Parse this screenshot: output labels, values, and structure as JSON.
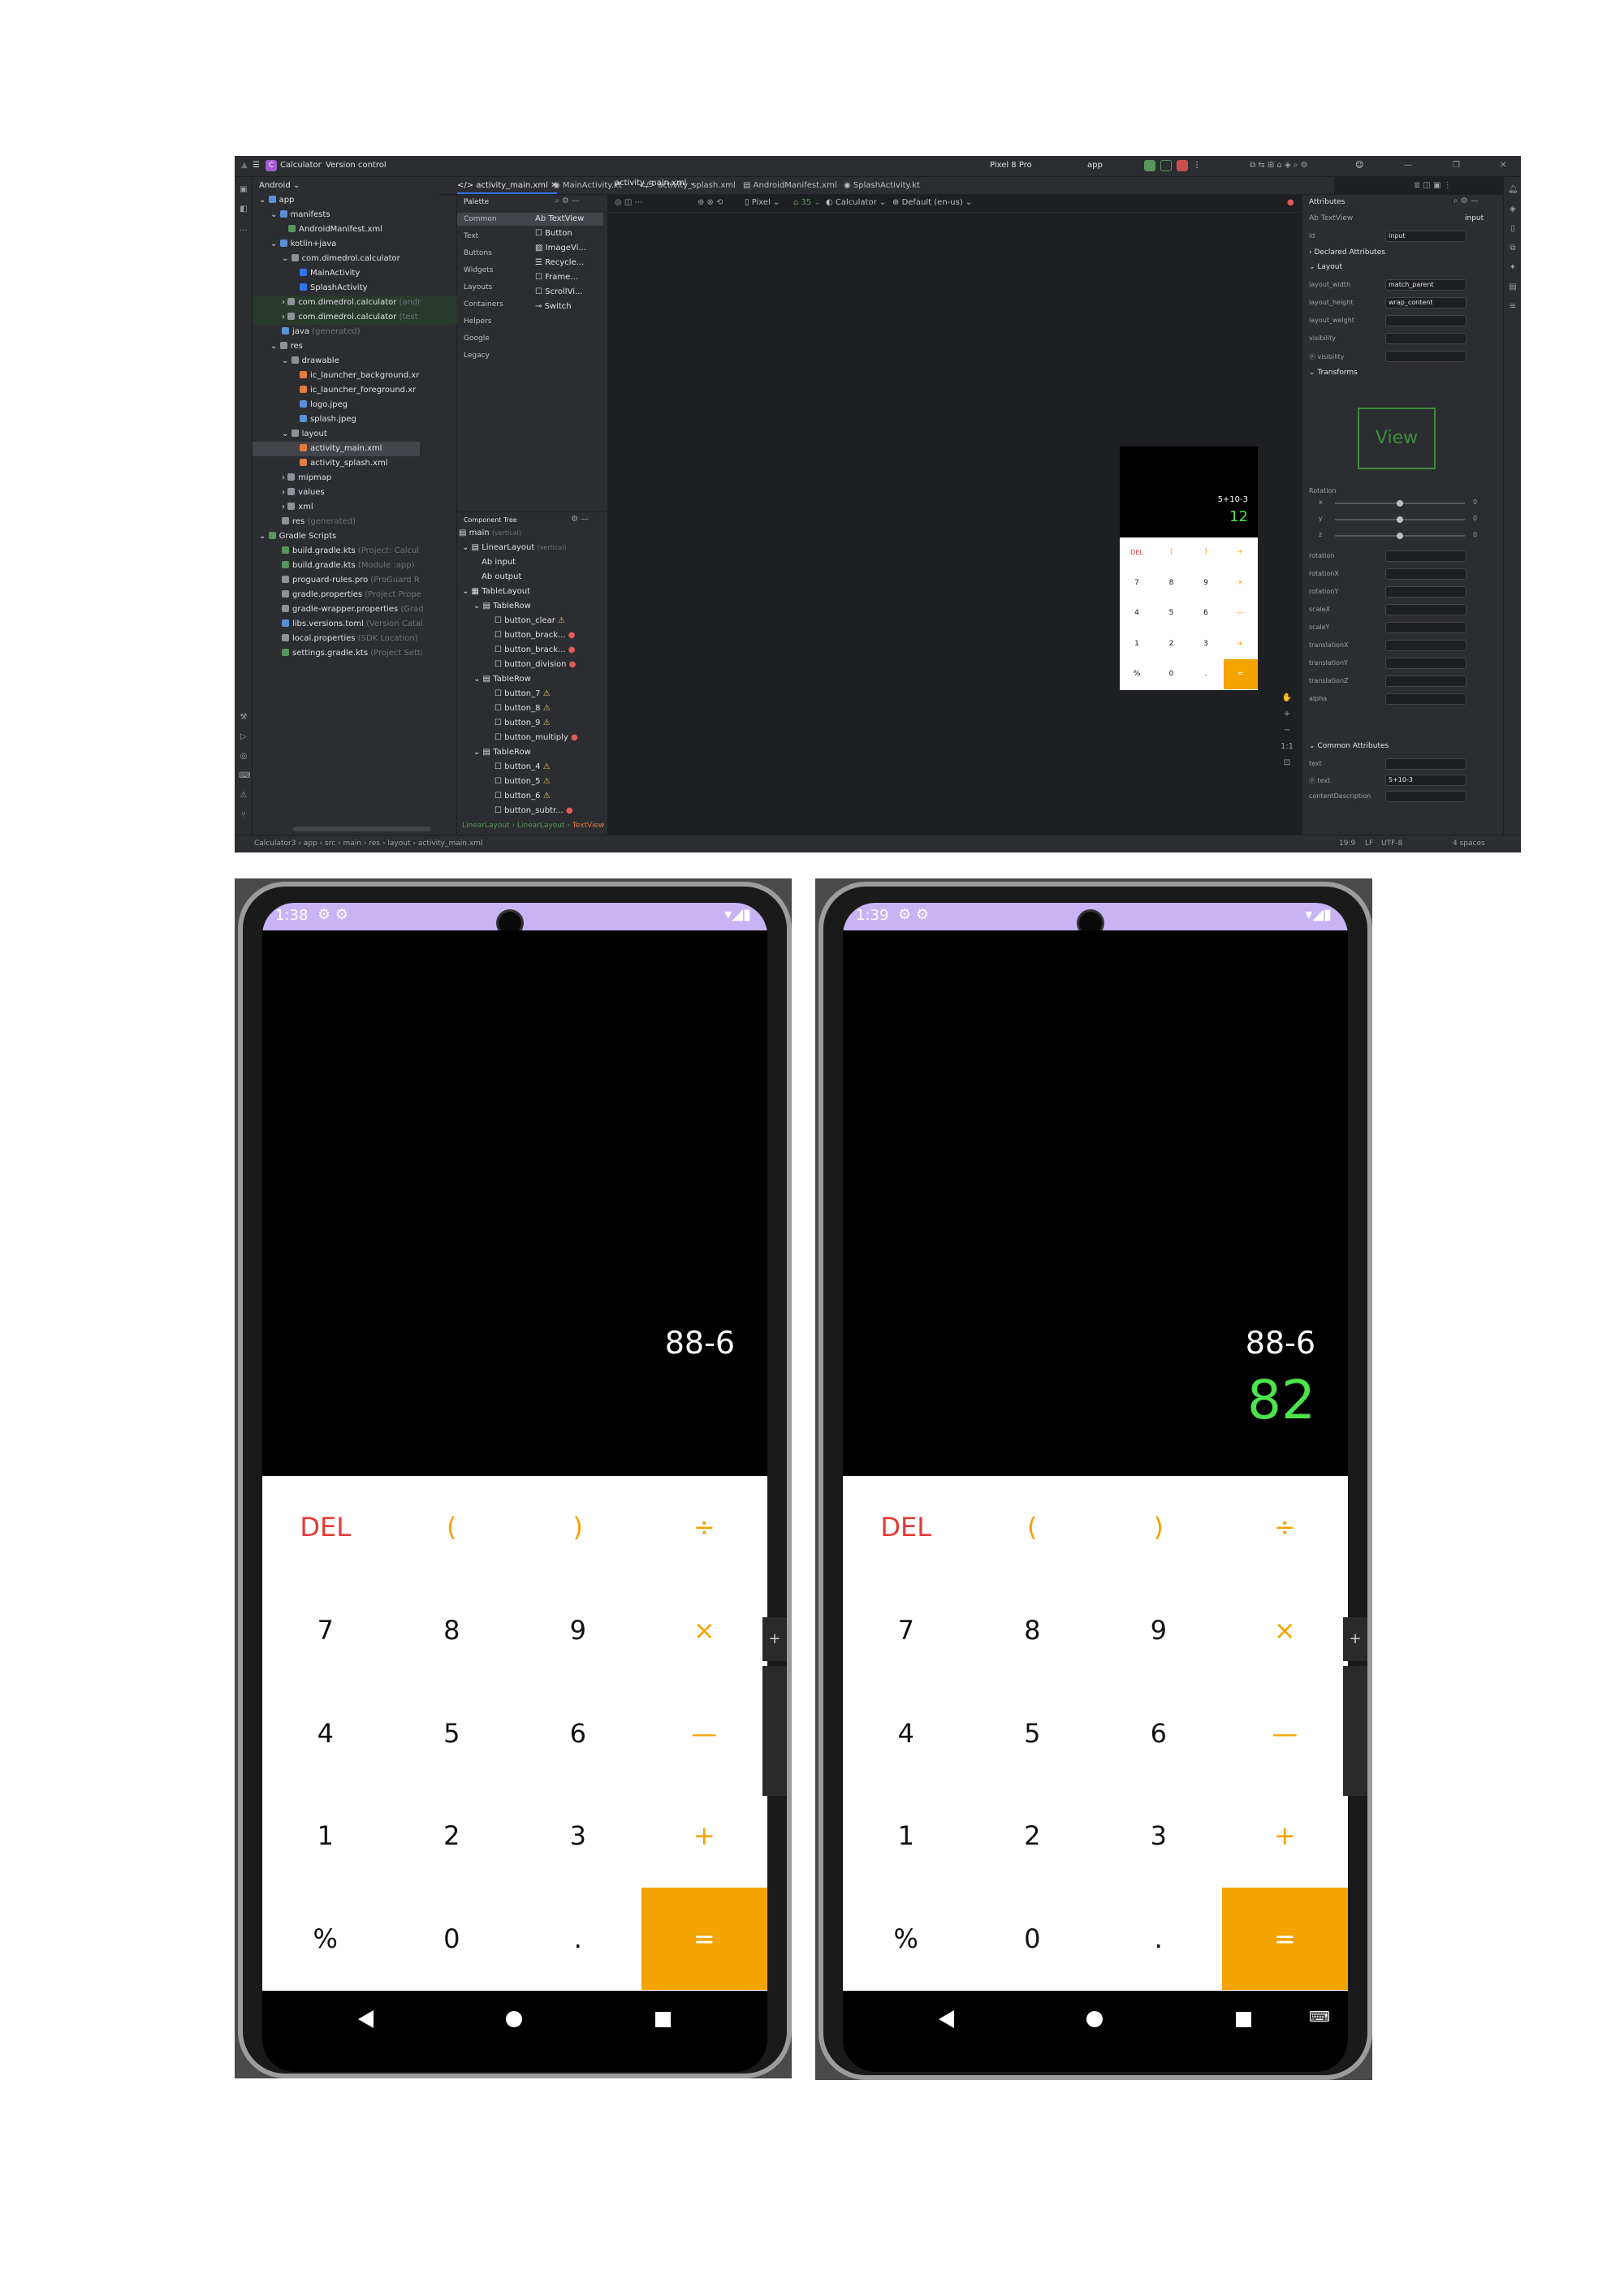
{
  "ide": {
    "project_name": "Calculator",
    "vcs": "Version control",
    "device": "Pixel 8 Pro",
    "run_config": "app",
    "tabs": [
      "activity_main.xml",
      "MainActivity.kt",
      "activity_splash.xml",
      "AndroidManifest.xml",
      "SplashActivity.kt"
    ],
    "project_view": "Android",
    "tree": {
      "app": "app",
      "manifests": "manifests",
      "android_manifest": "AndroidManifest.xml",
      "kotlin_java": "kotlin+java",
      "pkg1": "com.dimedrol.calculator",
      "main_activity": "MainActivity",
      "splash_activity": "SplashActivity",
      "pkg2": "com.dimedrol.calculator",
      "pkg2_hint": "(andr",
      "pkg3": "com.dimedrol.calculator",
      "pkg3_hint": "(test",
      "java_gen": "java",
      "java_gen_hint": "(generated)",
      "res": "res",
      "drawable": "drawable",
      "ic_bg": "ic_launcher_background.xr",
      "ic_fg": "ic_launcher_foreground.xr",
      "logo": "logo.jpeg",
      "splash": "splash.jpeg",
      "layout": "layout",
      "activity_main": "activity_main.xml",
      "activity_splash": "activity_splash.xml",
      "mipmap": "mipmap",
      "values": "values",
      "xml": "xml",
      "res_gen": "res",
      "res_gen_hint": "(generated)",
      "gradle_scripts": "Gradle Scripts",
      "build_project": "build.gradle.kts",
      "build_project_hint": "(Project: Calcul",
      "build_module": "build.gradle.kts",
      "build_module_hint": "(Module :app)",
      "proguard": "proguard-rules.pro",
      "proguard_hint": "(ProGuard R",
      "gradle_props": "gradle.properties",
      "gradle_props_hint": "(Project Prope",
      "wrapper_props": "gradle-wrapper.properties",
      "wrapper_props_hint": "(Grad",
      "libs_versions": "libs.versions.toml",
      "libs_versions_hint": "(Version Catal",
      "local_props": "local.properties",
      "local_props_hint": "(SDK Location)",
      "settings": "settings.gradle.kts",
      "settings_hint": "(Project Setti"
    },
    "palette": {
      "title": "Palette",
      "categories": [
        "Common",
        "Text",
        "Buttons",
        "Widgets",
        "Layouts",
        "Containers",
        "Helpers",
        "Google",
        "Legacy"
      ],
      "items": [
        "Ab TextView",
        "Button",
        "ImageVi...",
        "Recycle...",
        "Frame...",
        "ScrollVi...",
        "Switch"
      ]
    },
    "component_tree": {
      "title": "Component Tree",
      "rows": [
        "main",
        "LinearLayout",
        "input",
        "output",
        "TableLayout",
        "TableRow",
        "button_clear",
        "button_brack...",
        "button_brack...",
        "button_division",
        "TableRow",
        "button_7",
        "button_8",
        "button_9",
        "button_multiply",
        "TableRow",
        "button_4",
        "button_5",
        "button_6",
        "button_subtr..."
      ],
      "main_hint": "(vertical)",
      "linear_hint": "(vertical)"
    },
    "design_toolbar": {
      "file": "activity_main.xml",
      "device": "Pixel",
      "api": "35",
      "theme": "Calculator",
      "locale": "Default (en-us)"
    },
    "preview": {
      "expression": "5+10-3",
      "result": "12"
    },
    "attributes": {
      "title": "Attributes",
      "widget": "Ab TextView",
      "widget_id_right": "input",
      "id_label": "id",
      "id_value": "input",
      "declared": "Declared Attributes",
      "layout_section": "Layout",
      "layout_width_label": "layout_width",
      "layout_width_value": "match_parent",
      "layout_height_label": "layout_height",
      "layout_height_value": "wrap_content",
      "layout_weight_label": "layout_weight",
      "visibility_label": "visibility",
      "tools_visibility_label": "visibility",
      "transforms": "Transforms",
      "view_preview": "View",
      "rotation_label": "Rotation",
      "rotation_axes": [
        "x",
        "y",
        "z"
      ],
      "rotation_values": [
        "0",
        "0",
        "0"
      ],
      "transform_props": [
        "rotation",
        "rotationX",
        "rotationY",
        "scaleX",
        "scaleY",
        "translationX",
        "translationY",
        "translationZ",
        "alpha"
      ],
      "common": "Common Attributes",
      "text_label": "text",
      "tools_text_label": "text",
      "tools_text_value": "5+10-3",
      "content_desc_label": "contentDescription"
    },
    "breadcrumb_bottom": [
      "LinearLayout",
      "LinearLayout",
      "TextView"
    ],
    "status": {
      "path": [
        "Calculator3",
        "app",
        "src",
        "main",
        "res",
        "layout",
        "activity_main.xml"
      ],
      "position": "19:9",
      "line_ending": "LF",
      "encoding": "UTF-8",
      "indent": "4 spaces"
    }
  },
  "phones": [
    {
      "time": "1:38",
      "expression": "88-6",
      "result": ""
    },
    {
      "time": "1:39",
      "expression": "88-6",
      "result": "82"
    }
  ],
  "keypad": {
    "rows": [
      [
        "DEL",
        "(",
        ")",
        "÷"
      ],
      [
        "7",
        "8",
        "9",
        "×"
      ],
      [
        "4",
        "5",
        "6",
        "—"
      ],
      [
        "1",
        "2",
        "3",
        "+"
      ],
      [
        "%",
        "0",
        ".",
        "="
      ]
    ]
  },
  "colors": {
    "accent": "#f5a300",
    "del": "#e53935",
    "result": "#4ce34c",
    "status_bar": "#c8b4f5"
  }
}
